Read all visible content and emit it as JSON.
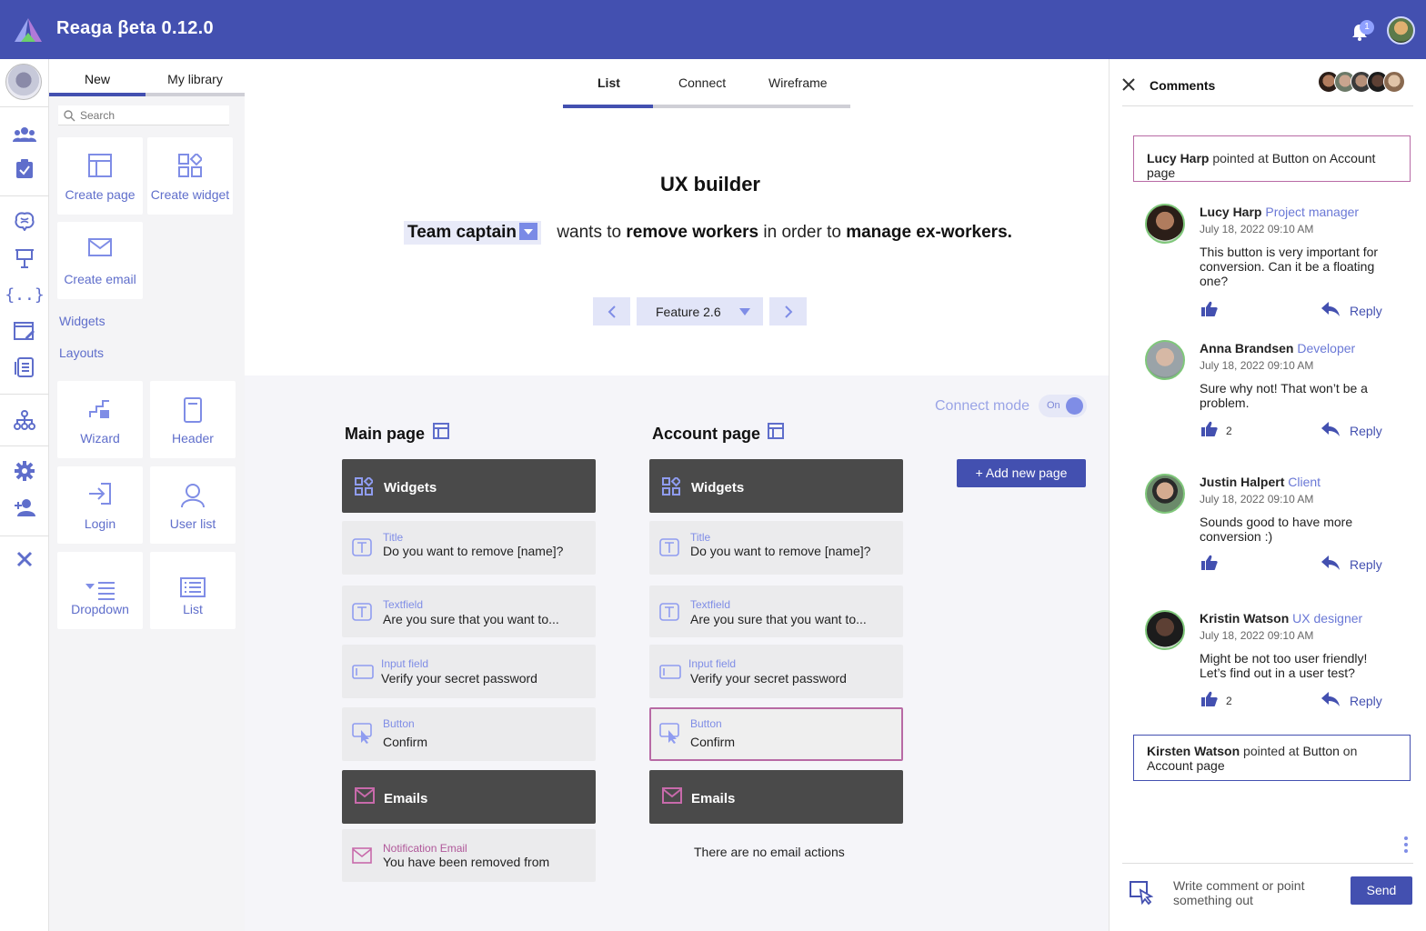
{
  "app": {
    "title": "Reaga βeta 0.12.0",
    "notifications": "1"
  },
  "left_panel": {
    "tabs": [
      "New",
      "My library"
    ],
    "search_placeholder": "Search",
    "tiles_top": [
      "Create page",
      "Create widget",
      "Create email"
    ],
    "links": [
      "Widgets",
      "Layouts"
    ],
    "tiles_widgets": [
      "Wizard",
      "Header",
      "Login",
      "User list",
      "Dropdown",
      "List"
    ]
  },
  "center": {
    "tabs": [
      "List",
      "Connect",
      "Wireframe"
    ],
    "title": "UX builder",
    "story": {
      "role": "Team captain",
      "wants": "wants to",
      "action": "remove workers",
      "in_order": "in order to",
      "goal": "manage ex-workers."
    },
    "feature": "Feature 2.6",
    "connect_mode": {
      "label": "Connect mode",
      "state": "On"
    },
    "add_page": "+  Add new page",
    "pages": [
      {
        "title": "Main page",
        "widgets_label": "Widgets",
        "widgets": [
          {
            "type": "Title",
            "value": "Do you want to remove [name]?"
          },
          {
            "type": "Textfield",
            "value": "Are you sure that you want to..."
          },
          {
            "type": "Input field",
            "value": "Verify your secret password"
          },
          {
            "type": "Button",
            "value": "Confirm"
          }
        ],
        "emails_label": "Emails",
        "email": {
          "type": "Notification Email",
          "value": "You have been removed from"
        }
      },
      {
        "title": "Account page",
        "widgets_label": "Widgets",
        "widgets": [
          {
            "type": "Title",
            "value": "Do you want to remove [name]?"
          },
          {
            "type": "Textfield",
            "value": "Are you sure that you want to..."
          },
          {
            "type": "Input field",
            "value": "Verify your secret password"
          },
          {
            "type": "Button",
            "value": "Confirm"
          }
        ],
        "emails_label": "Emails",
        "no_email": "There are no email actions"
      }
    ]
  },
  "comments": {
    "title": "Comments",
    "pointer_top": {
      "name": "Lucy Harp",
      "text1": " pointed at ",
      "target": "Button",
      "text2": " on ",
      "page": "Account page"
    },
    "items": [
      {
        "name": "Lucy Harp",
        "role": "Project manager",
        "date": "July 18, 2022 09:10 AM",
        "text": "This button is very important for conversion. Can it be a floating one?",
        "likes": "",
        "reply": "Reply"
      },
      {
        "name": "Anna Brandsen",
        "role": "Developer",
        "date": "July 18, 2022 09:10 AM",
        "text": "Sure why not! That won’t be a problem.",
        "likes": "2",
        "reply": "Reply"
      },
      {
        "name": "Justin Halpert",
        "role": "Client",
        "date": "July 18, 2022 09:10 AM",
        "text": "Sounds good to have more conversion :)",
        "likes": "",
        "reply": "Reply"
      },
      {
        "name": "Kristin Watson",
        "role": "UX designer",
        "date": "July 18, 2022 09:10 AM",
        "text": "Might be not too user friendly! Let’s find out in a user test?",
        "likes": "2",
        "reply": "Reply"
      }
    ],
    "pointer_bottom": {
      "name": "Kirsten Watson",
      "text1": " pointed at ",
      "target": "Button",
      "text2": " on ",
      "page": "Account page"
    },
    "compose_placeholder": "Write comment or point something out",
    "send": "Send"
  },
  "colors": {
    "brand": "#4350b0",
    "accent": "#7f8de6",
    "email": "#b0589a",
    "dark_block": "#4a4a4a"
  }
}
